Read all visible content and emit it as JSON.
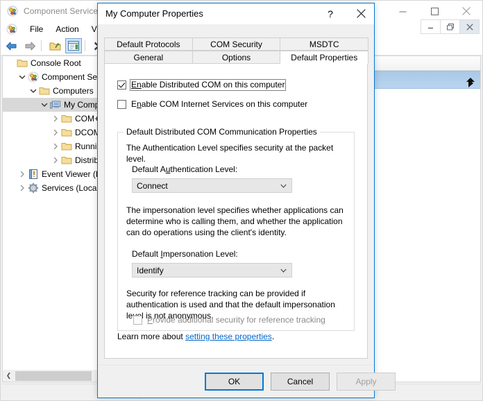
{
  "mmc": {
    "title": "Component Services",
    "title_icon": "component-services-icon",
    "menus": [
      {
        "label": "File"
      },
      {
        "label": "Action"
      },
      {
        "label": "View"
      }
    ],
    "toolbar": [
      {
        "name": "back-button",
        "icon": "arrow-left-icon"
      },
      {
        "name": "forward-button",
        "icon": "arrow-right-icon"
      },
      {
        "name": "up-one-level-button",
        "icon": "folder-up-icon"
      },
      {
        "name": "show-hide-console-tree-button",
        "icon": "console-tree-icon",
        "active": true
      },
      {
        "name": "delete-button",
        "icon": "delete-x-icon"
      }
    ],
    "caption_buttons": [
      {
        "name": "minimize-button",
        "icon": "minimize-icon"
      },
      {
        "name": "maximize-button",
        "icon": "maximize-icon"
      },
      {
        "name": "close-button",
        "icon": "close-icon"
      }
    ],
    "mdi_caption_buttons": [
      {
        "name": "mdi-minimize-button",
        "icon": "minimize-icon"
      },
      {
        "name": "mdi-restore-button",
        "icon": "restore-icon"
      },
      {
        "name": "mdi-close-button",
        "icon": "close-icon"
      }
    ],
    "tree": [
      {
        "label": "Console Root",
        "depth": 0,
        "icon": "folder-icon",
        "expander": "none",
        "selected": false
      },
      {
        "label": "Component Servi",
        "depth": 1,
        "icon": "component-services-icon",
        "expander": "expanded",
        "selected": false
      },
      {
        "label": "Computers",
        "depth": 2,
        "icon": "folder-icon",
        "expander": "expanded",
        "selected": false
      },
      {
        "label": "My Comp",
        "depth": 3,
        "icon": "computer-icon",
        "expander": "expanded",
        "selected": true
      },
      {
        "label": "COM+",
        "depth": 4,
        "icon": "folder-icon",
        "expander": "collapsed",
        "selected": false
      },
      {
        "label": "DCOM",
        "depth": 4,
        "icon": "folder-icon",
        "expander": "collapsed",
        "selected": false
      },
      {
        "label": "Running",
        "depth": 4,
        "icon": "folder-icon",
        "expander": "collapsed",
        "selected": false
      },
      {
        "label": "Distrib",
        "depth": 4,
        "icon": "folder-icon",
        "expander": "collapsed",
        "selected": false
      },
      {
        "label": "Event Viewer (Loc",
        "depth": 1,
        "icon": "event-viewer-icon",
        "expander": "collapsed",
        "selected": false
      },
      {
        "label": "Services (Local)",
        "depth": 1,
        "icon": "services-icon",
        "expander": "collapsed",
        "selected": false
      }
    ],
    "tree_scrollbar": {
      "left_arrow": "❮"
    }
  },
  "dialog": {
    "title": "My Computer Properties",
    "help_label": "?",
    "close_icon": "close-icon",
    "tabs_row1": [
      {
        "label": "Default Protocols",
        "selected": false
      },
      {
        "label": "COM Security",
        "selected": false
      },
      {
        "label": "MSDTC",
        "selected": false
      }
    ],
    "tabs_row2": [
      {
        "label": "General",
        "selected": false
      },
      {
        "label": "Options",
        "selected": false
      },
      {
        "label": "Default Properties",
        "selected": true
      }
    ],
    "checkboxes": {
      "enable_dcom": {
        "label_pre": "E",
        "label_accel": "n",
        "label_post": "able Distributed COM on this computer",
        "checked": true,
        "enabled": true,
        "focused": true
      },
      "enable_cis": {
        "label_pre": "E",
        "label_accel": "n",
        "label_post": "able COM Internet Services on this computer",
        "checked": false,
        "enabled": true,
        "focused": false
      },
      "reference_tracking": {
        "label_pre": "",
        "label_accel": "P",
        "label_post": "rovide additional security for reference tracking",
        "checked": false,
        "enabled": false,
        "focused": false
      }
    },
    "group": {
      "legend": "Default Distributed COM Communication Properties",
      "auth_description": "The Authentication Level specifies security at the packet level.",
      "auth_label_pre": "Default A",
      "auth_label_accel": "u",
      "auth_label_post": "thentication Level:",
      "auth_value": "Connect",
      "impersonation_description": "The impersonation level specifies whether applications can determine who is calling them, and whether the application can do operations using the client's identity.",
      "imp_label_pre": "Default ",
      "imp_label_accel": "I",
      "imp_label_post": "mpersonation Level:",
      "imp_value": "Identify",
      "ref_tracking_description": "Security for reference tracking can be provided if authentication is used and that the default impersonation level is not anonymous."
    },
    "learn_more": {
      "prefix": "Learn more about ",
      "link": "setting these properties",
      "suffix": "."
    },
    "buttons": [
      {
        "name": "ok-button",
        "label": "OK",
        "state": "default"
      },
      {
        "name": "cancel-button",
        "label": "Cancel",
        "state": "normal"
      },
      {
        "name": "apply-button",
        "label": "Apply",
        "state": "disabled"
      }
    ]
  },
  "colors": {
    "accent": "#0078d7",
    "link": "#0066cc",
    "selection_tree": "#d8d8d8",
    "selection_list": "#a9c9e8",
    "dialog_face": "#f0f0f0"
  }
}
